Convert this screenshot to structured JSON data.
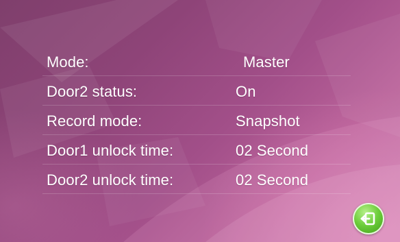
{
  "settings": {
    "rows": [
      {
        "label": "Mode:",
        "value": "Master"
      },
      {
        "label": "Door2 status:",
        "value": "On"
      },
      {
        "label": "Record mode:",
        "value": "Snapshot"
      },
      {
        "label": "Door1 unlock time:",
        "value": "02 Second"
      },
      {
        "label": "Door2 unlock time:",
        "value": "02 Second"
      }
    ]
  },
  "icons": {
    "back": "back-arrow-icon"
  },
  "colors": {
    "background": "#9b4a84",
    "text": "#ffffff",
    "back_button": "#5bbd2e"
  }
}
